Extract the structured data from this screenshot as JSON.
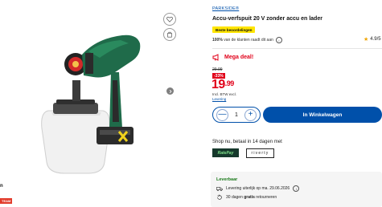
{
  "gallery": {
    "image_alt": "Parkside paint sprayer with container",
    "favorite_icon": "heart-icon",
    "compare_icon": "compare-icon",
    "next_icon": "chevron-right-icon",
    "side_text": "n",
    "side_badge": "TEAM"
  },
  "product": {
    "brand": "PARKSIDE®",
    "title": "Accu-verfspuit 20 V zonder accu en lader",
    "badge": "Beste beoordelingen",
    "recommend_pct": "100%",
    "recommend_text": "van de klanten raadt dit aan",
    "rating": "4.9/5"
  },
  "deal": {
    "label": "Mega deal!",
    "old_price": "29.99",
    "discount": "-33%",
    "price_main": "19",
    "price_cents": ".99",
    "vat_line1": "Incl. BTW excl.",
    "vat_line2": "Levering"
  },
  "cart": {
    "quantity": "1",
    "minus": "—",
    "plus": "+",
    "button_label": "In Winkelwagen"
  },
  "payment": {
    "text": "Shop nu, betaal in 14 dagen met",
    "logo1": "RatePay",
    "logo2": "riverty"
  },
  "delivery": {
    "title": "Leverbaar",
    "row1": "Levering uiterlijk op ma. 29.06.2026",
    "row2_prefix": "30 dagen",
    "row2_bold": "gratis",
    "row2_suffix": "retourneren"
  },
  "colors": {
    "accent": "#0050aa",
    "deal_red": "#e10019",
    "badge_yellow": "#ffe500",
    "delivery_green": "#1b7a1b"
  }
}
